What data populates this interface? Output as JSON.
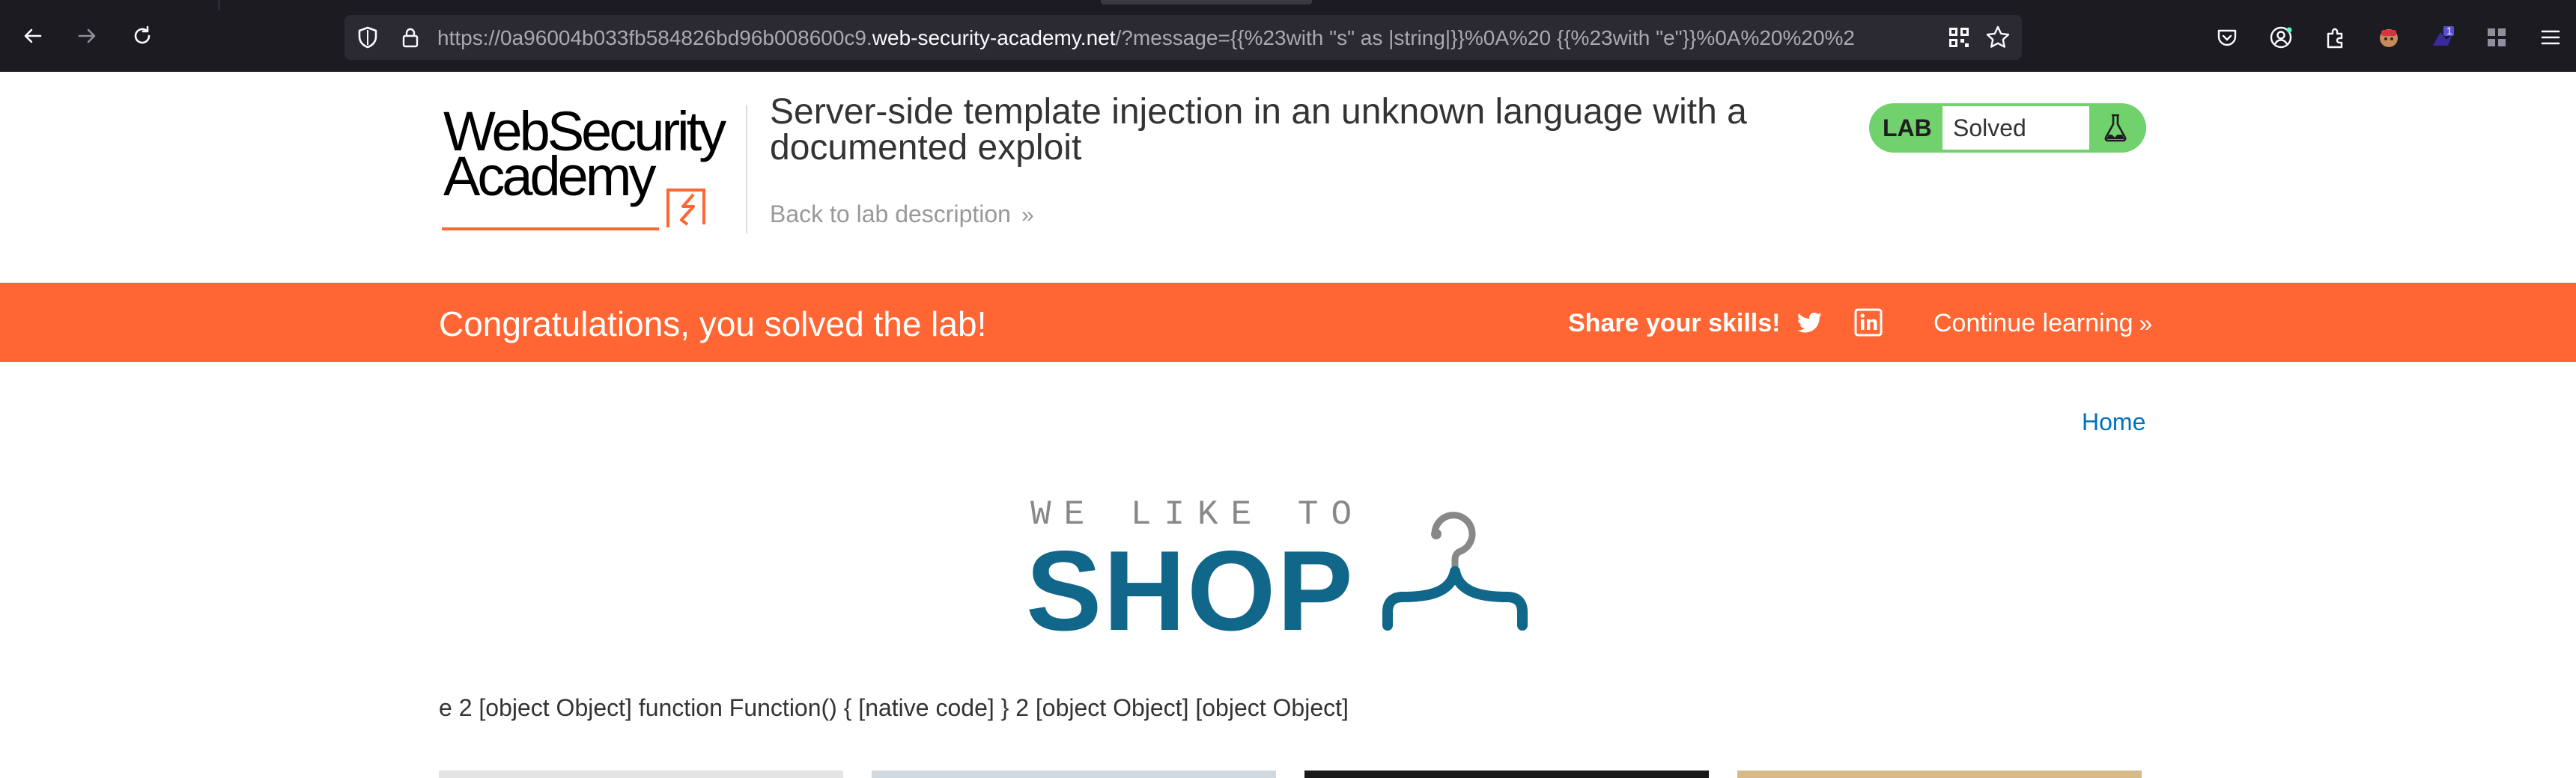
{
  "browser": {
    "url_prefix": "https://0a96004b033fb584826bd96b008600c9.",
    "url_host": "web-security-academy.net",
    "url_suffix": "/?message={{%23with \"s\" as |string|}}%0A%20 {{%23with \"e\"}}%0A%20%20%2",
    "extension_badge": "1"
  },
  "header": {
    "logo_line1": "WebSecurity",
    "logo_line2": "Academy",
    "lab_title": "Server-side template injection in an unknown language with a documented exploit",
    "back_link": "Back to lab description",
    "back_chevron": "»",
    "lab_tag": "LAB",
    "lab_status": "Solved"
  },
  "banner": {
    "message": "Congratulations, you solved the lab!",
    "share_label": "Share your skills!",
    "continue_label": "Continue learning",
    "continue_chevron": "»"
  },
  "page": {
    "home_link": "Home",
    "shop_tagline": "WE LIKE TO",
    "shop_word": "SHOP",
    "message": "e 2 [object Object] function Function() { [native code] } 2 [object Object] [object Object]"
  },
  "colors": {
    "accent": "#ff6633",
    "lab_green": "#70d16d",
    "link_blue": "#0071bc",
    "shop_blue": "#11678a",
    "chrome_bg": "#1c1b22"
  },
  "icons": [
    "back-arrow-icon",
    "forward-arrow-icon",
    "reload-icon",
    "shield-icon",
    "lock-icon",
    "qr-code-icon",
    "bookmark-star-icon",
    "pocket-icon",
    "account-icon",
    "extensions-icon",
    "avatar-extension-icon",
    "purple-extension-icon",
    "grid-extension-icon",
    "menu-icon",
    "twitter-icon",
    "linkedin-icon",
    "flask-icon",
    "hanger-icon"
  ]
}
